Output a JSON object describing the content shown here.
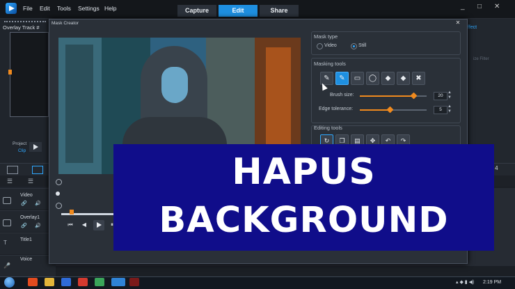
{
  "app": {
    "menu": [
      "File",
      "Edit",
      "Tools",
      "Settings",
      "Help"
    ],
    "tabs": [
      "Capture",
      "Edit",
      "Share"
    ],
    "active_tab": "Edit",
    "window_controls": [
      "_",
      "□",
      "✕"
    ],
    "accent_color": "#1e8fe0",
    "highlight_color": "#f08a1e"
  },
  "left_panel": {
    "overlay_track_label": "Overlay Track #",
    "project_label": "Project",
    "clip_label": "Clip"
  },
  "right_panel": {
    "effect_label": "ffect",
    "filter_label": "ize Filter",
    "counter": "5 : 4"
  },
  "dialog": {
    "title": "Mask Creator",
    "close": "✕",
    "mask_type": {
      "title": "Mask type",
      "options": [
        "Video",
        "Still"
      ],
      "selected": "Still"
    },
    "masking_tools": {
      "title": "Masking tools",
      "tools": [
        "brush-icon",
        "smart-brush-icon",
        "rectangle-select-icon",
        "ellipse-select-icon",
        "eraser-icon",
        "smart-eraser-icon",
        "clear-mask-icon"
      ],
      "selected_tool": "smart-brush-icon",
      "brush_size_label": "Brush size:",
      "brush_size_value": "20",
      "brush_size_level": 0.8,
      "edge_tolerance_label": "Edge tolerance:",
      "edge_tolerance_value": "5",
      "edge_tolerance_level": 0.45
    },
    "editing_tools": {
      "title": "Editing tools",
      "tools": [
        "rotate-icon",
        "copy-icon",
        "paste-icon",
        "move-icon",
        "undo-icon",
        "redo-icon"
      ]
    },
    "transport": [
      "⏮",
      "◀",
      "▶",
      "⏸"
    ],
    "scrub_level": 0.2
  },
  "tracks": {
    "labels": [
      "Video",
      "Overlay1",
      "Title1",
      "Voice"
    ]
  },
  "banner": {
    "line1": "HAPUS",
    "line2": "BACKGROUND"
  },
  "taskbar": {
    "time": "2:19 PM"
  }
}
